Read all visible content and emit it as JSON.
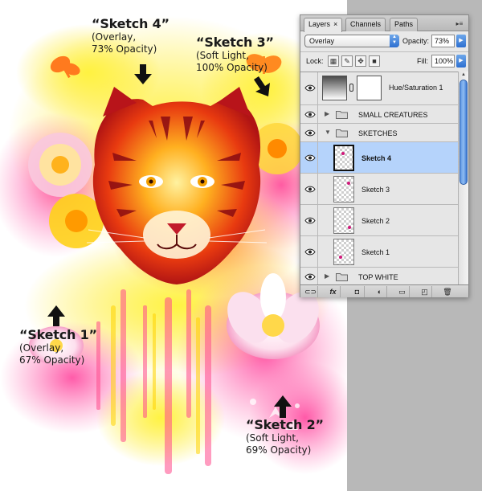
{
  "annotations": [
    {
      "title": "“Sketch 4”",
      "desc1": "(Overlay,",
      "desc2": "73% Opacity)"
    },
    {
      "title": "“Sketch 3”",
      "desc1": "(Soft Light,",
      "desc2": "100% Opacity)"
    },
    {
      "title": "“Sketch 1”",
      "desc1": "(Overlay,",
      "desc2": "67% Opacity)"
    },
    {
      "title": "“Sketch 2”",
      "desc1": "(Soft Light,",
      "desc2": "69% Opacity)"
    }
  ],
  "panel": {
    "tabs": [
      "Layers",
      "Channels",
      "Paths"
    ],
    "close_glyph": "×",
    "menu_glyph": "▸≡",
    "blend_mode": "Overlay",
    "opacity_label": "Opacity:",
    "opacity_value": "73%",
    "lock_label": "Lock:",
    "fill_label": "Fill:",
    "fill_value": "100%",
    "layers": [
      {
        "name": "Hue/Saturation 1",
        "kind": "adjustment",
        "visible": true
      },
      {
        "name": "SMALL CREATURES",
        "kind": "group",
        "expanded": false,
        "visible": true
      },
      {
        "name": "SKETCHES",
        "kind": "group",
        "expanded": true,
        "visible": true
      },
      {
        "name": "Sketch 4",
        "kind": "layer",
        "selected": true,
        "visible": true
      },
      {
        "name": "Sketch 3",
        "kind": "layer",
        "visible": true
      },
      {
        "name": "Sketch 2",
        "kind": "layer",
        "visible": true
      },
      {
        "name": "Sketch 1",
        "kind": "layer",
        "visible": true
      },
      {
        "name": "TOP WHITE",
        "kind": "group",
        "expanded": false,
        "visible": true
      }
    ],
    "bottom_buttons": [
      "link-icon",
      "fx-icon",
      "mask-icon",
      "adjustment-icon",
      "new-group-icon",
      "new-layer-icon",
      "trash-icon"
    ],
    "bottom_glyphs": [
      "⊂⊃",
      "fx",
      "◘",
      "◐",
      "▭",
      "◰",
      "🗑"
    ]
  },
  "colors": {
    "selected_row": "#b5d3fb",
    "accent_blue": "#2d6fd0",
    "gray_background": "#b8b8b8"
  }
}
